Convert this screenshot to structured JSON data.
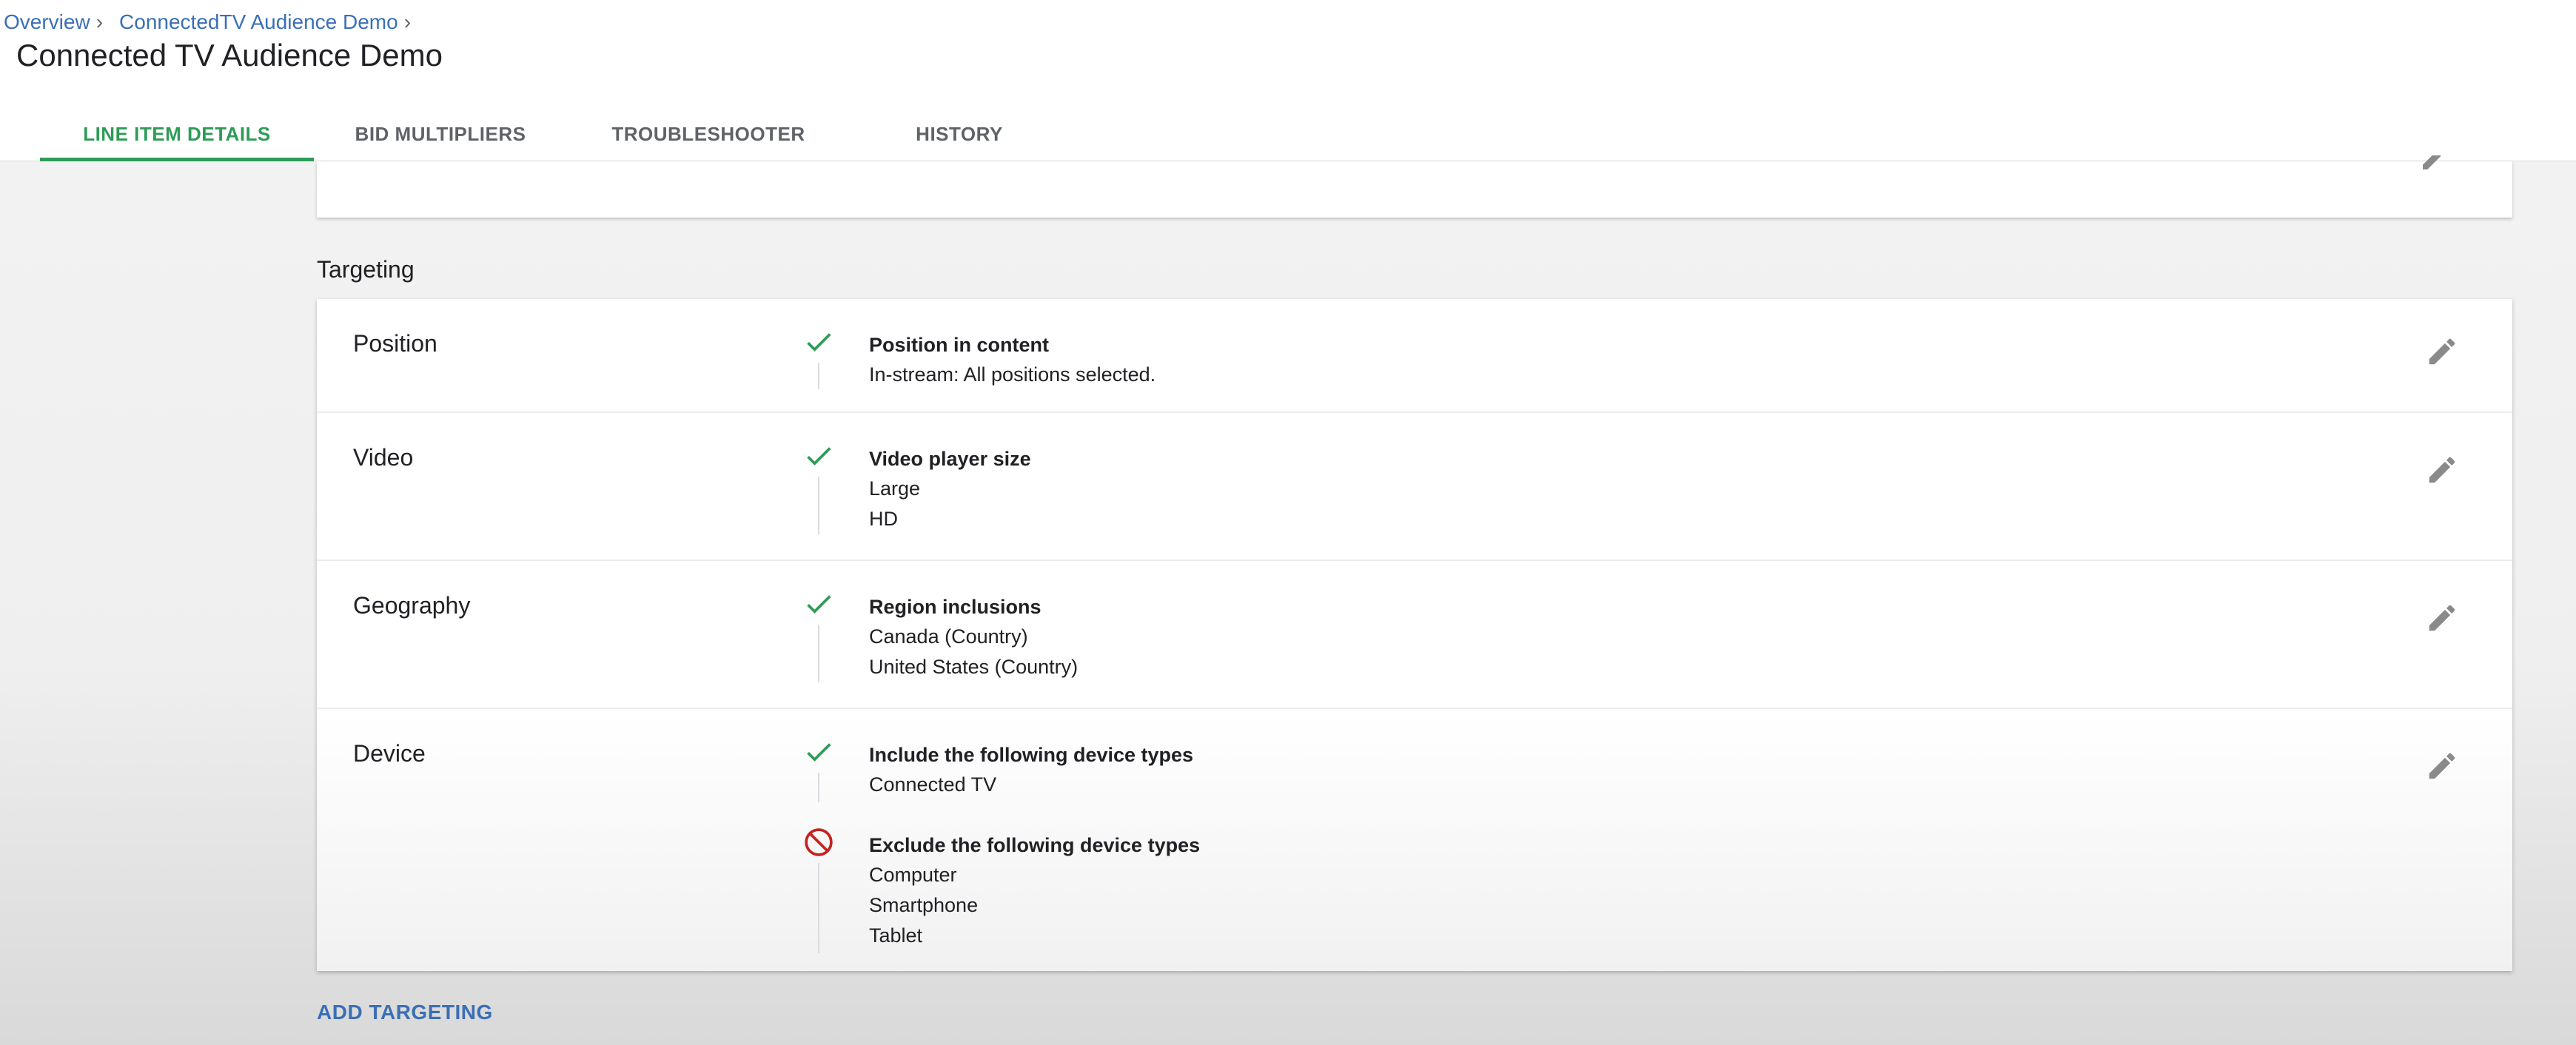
{
  "breadcrumb": [
    {
      "label": "Overview"
    },
    {
      "label": "ConnectedTV Audience Demo"
    }
  ],
  "breadcrumb_separator": "›",
  "page_title": "Connected TV Audience Demo",
  "tabs": [
    {
      "label": "LINE ITEM DETAILS",
      "active": true
    },
    {
      "label": "BID MULTIPLIERS",
      "active": false
    },
    {
      "label": "TROUBLESHOOTER",
      "active": false
    },
    {
      "label": "HISTORY",
      "active": false
    }
  ],
  "targeting": {
    "section_title": "Targeting",
    "rows": [
      {
        "label": "Position",
        "groups": [
          {
            "type": "include",
            "heading": "Position in content",
            "items": [
              "In-stream: All positions selected."
            ]
          }
        ]
      },
      {
        "label": "Video",
        "groups": [
          {
            "type": "include",
            "heading": "Video player size",
            "items": [
              "Large",
              "HD"
            ]
          }
        ]
      },
      {
        "label": "Geography",
        "groups": [
          {
            "type": "include",
            "heading": "Region inclusions",
            "items": [
              "Canada (Country)",
              "United States (Country)"
            ]
          }
        ]
      },
      {
        "label": "Device",
        "groups": [
          {
            "type": "include",
            "heading": "Include the following device types",
            "items": [
              "Connected TV"
            ]
          },
          {
            "type": "exclude",
            "heading": "Exclude the following device types",
            "items": [
              "Computer",
              "Smartphone",
              "Tablet"
            ]
          }
        ]
      }
    ],
    "add_label": "ADD TARGETING"
  },
  "icons": {
    "include": "check-icon",
    "exclude": "blocked-icon",
    "edit": "pencil-icon"
  },
  "colors": {
    "accent_green": "#2e9c57",
    "link_blue": "#3a6fb5",
    "exclude_red": "#c5221f"
  }
}
